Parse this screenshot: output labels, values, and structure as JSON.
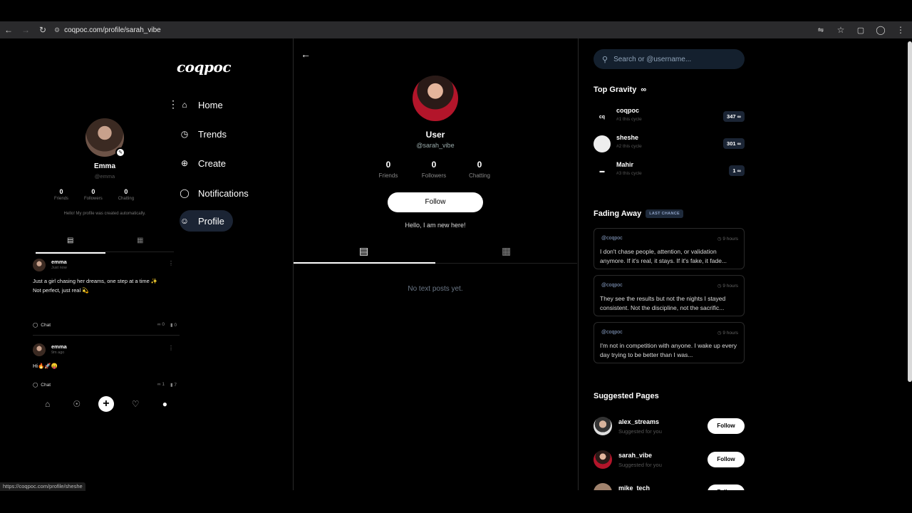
{
  "browser": {
    "url": "coqpoc.com/profile/sarah_vibe",
    "status_url": "https://coqpoc.com/profile/sheshe"
  },
  "app": {
    "logo": "coqpoc",
    "nav": [
      {
        "label": "Home",
        "icon": "home-icon"
      },
      {
        "label": "Trends",
        "icon": "trends-icon"
      },
      {
        "label": "Create",
        "icon": "create-icon"
      },
      {
        "label": "Notifications",
        "icon": "notifications-icon"
      },
      {
        "label": "Profile",
        "icon": "profile-icon",
        "active": true
      }
    ]
  },
  "preview": {
    "name": "Emma",
    "handle": "@emma",
    "stats": [
      {
        "value": "0",
        "label": "Friends"
      },
      {
        "value": "0",
        "label": "Followers"
      },
      {
        "value": "0",
        "label": "Chatting"
      }
    ],
    "bio": "Hello! My profile was created automatically.",
    "posts": [
      {
        "author": "emma",
        "time": "Just now",
        "text": "Just a girl chasing her dreams, one step at a time ✨\nNot perfect, just real 💫",
        "chat": "Chat",
        "infinity": "0",
        "views": "0"
      },
      {
        "author": "emma",
        "time": "9m ago",
        "text": "Hi🔥🚀😛",
        "chat": "Chat",
        "infinity": "1",
        "views": "7"
      }
    ]
  },
  "profile": {
    "name": "User",
    "handle": "@sarah_vibe",
    "stats": [
      {
        "value": "0",
        "label": "Friends"
      },
      {
        "value": "0",
        "label": "Followers"
      },
      {
        "value": "0",
        "label": "Chatting"
      }
    ],
    "follow_label": "Follow",
    "bio": "Hello, I am new here!",
    "empty_text": "No text posts yet."
  },
  "sidebar": {
    "search_placeholder": "Search or @username...",
    "top_gravity": {
      "title": "Top Gravity",
      "symbol": "∞",
      "items": [
        {
          "name": "coqpoc",
          "sub": "#1 this cycle",
          "score": "347 ∞"
        },
        {
          "name": "sheshe",
          "sub": "#2 this cycle",
          "score": "301 ∞"
        },
        {
          "name": "Mahir",
          "sub": "#3 this cycle",
          "score": "1 ∞"
        }
      ]
    },
    "fading": {
      "title": "Fading Away",
      "badge": "LAST CHANCE",
      "items": [
        {
          "handle": "@coqpoc",
          "time": "9 hours",
          "text": "I don't chase people, attention, or validation anymore. If it's real, it stays. If it's fake, it fade..."
        },
        {
          "handle": "@coqpoc",
          "time": "9 hours",
          "text": "They see the results but not the nights I stayed consistent. Not the discipline, not the sacrific..."
        },
        {
          "handle": "@coqpoc",
          "time": "9 hours",
          "text": "I'm not in competition with anyone. I wake up every day trying to be better than I was..."
        }
      ]
    },
    "suggested": {
      "title": "Suggested Pages",
      "items": [
        {
          "name": "alex_streams",
          "sub": "Suggested for you",
          "button": "Follow"
        },
        {
          "name": "sarah_vibe",
          "sub": "Suggested for you",
          "button": "Follow"
        },
        {
          "name": "mike_tech",
          "sub": "",
          "button": "Follow"
        }
      ]
    }
  }
}
